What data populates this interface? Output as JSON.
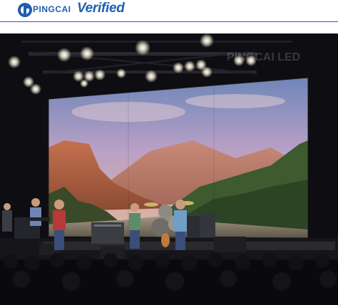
{
  "header": {
    "brand_name": "PINGCAI",
    "verified_label": "Verified",
    "logo_icon": "pingcai-logo-icon",
    "colors": {
      "brand": "#1f5fb0",
      "background": "#ffffff"
    }
  },
  "photo": {
    "watermark_text": "PINGCAI LED",
    "scene_icon": "concert-stage-photo"
  }
}
